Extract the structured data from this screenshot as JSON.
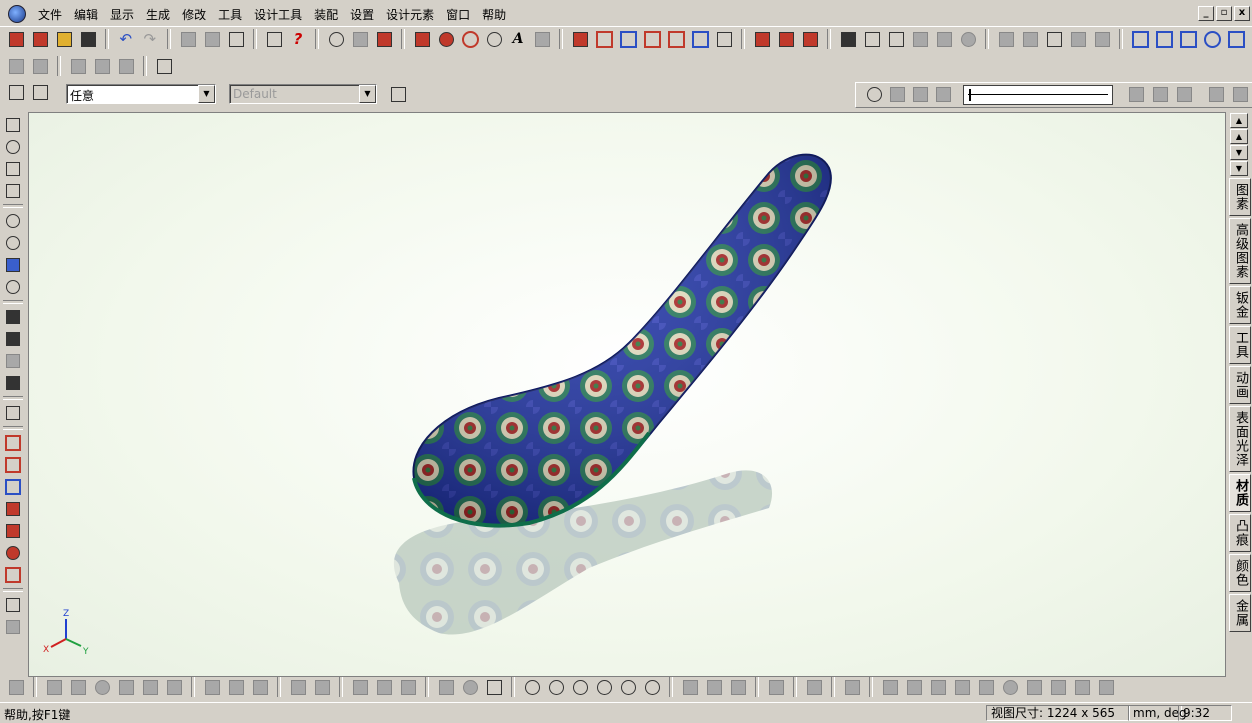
{
  "menubar": {
    "items": [
      "文件",
      "编辑",
      "显示",
      "生成",
      "修改",
      "工具",
      "设计工具",
      "装配",
      "设置",
      "设计元素",
      "窗口",
      "帮助"
    ],
    "window_buttons": [
      "_",
      "▫",
      "x"
    ]
  },
  "toolbar3": {
    "select_filter": "任意",
    "config_combo": "Default"
  },
  "right_tabs": {
    "items": [
      "图素",
      "高级图素",
      "钣金",
      "工具",
      "动画",
      "表面光泽",
      "材质",
      "凸痕",
      "颜色",
      "金属"
    ],
    "active": "材质"
  },
  "viewport": {
    "axes": {
      "z": "Z",
      "x": "X",
      "y": "Y"
    },
    "colors": {
      "spoon_base": "#1a2fa8",
      "spoon_rim": "#1f7a5a",
      "pattern_red": "#b02020",
      "pattern_cream": "#f0e8c8",
      "shadow": "#9fb0a0"
    }
  },
  "statusbar": {
    "help": "帮助,按F1键",
    "view_size_label": "视图尺寸:",
    "view_size_value": "1224 x 565",
    "units": "mm, deg",
    "time": "9:32"
  }
}
